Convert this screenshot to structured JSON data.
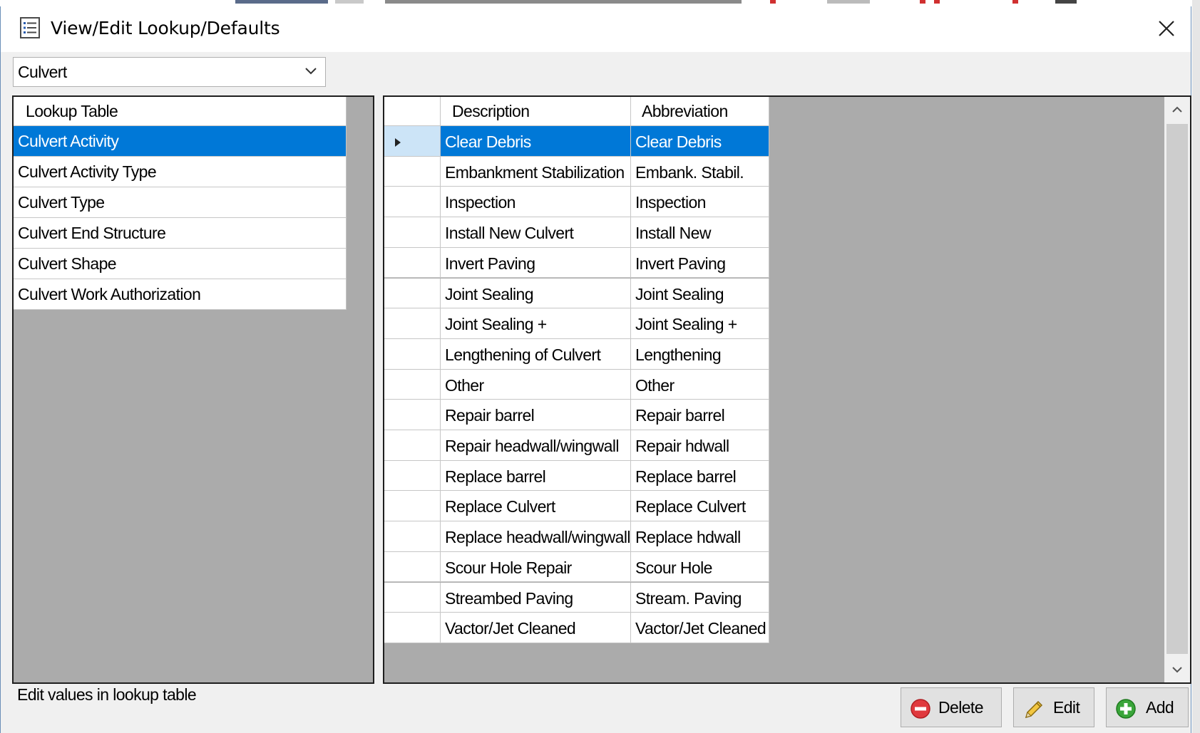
{
  "window": {
    "title": "View/Edit Lookup/Defaults",
    "icon": "list-icon"
  },
  "category_select": {
    "value": "Culvert"
  },
  "lookup_table": {
    "header": "Lookup Table",
    "items": [
      {
        "label": "Culvert Activity",
        "selected": true
      },
      {
        "label": "Culvert Activity Type",
        "selected": false
      },
      {
        "label": "Culvert Type",
        "selected": false
      },
      {
        "label": "Culvert End Structure",
        "selected": false
      },
      {
        "label": "Culvert Shape",
        "selected": false
      },
      {
        "label": "Culvert Work Authorization",
        "selected": false
      }
    ]
  },
  "values_grid": {
    "columns": [
      "Description",
      "Abbreviation"
    ],
    "rows": [
      [
        "Clear Debris",
        "Clear Debris"
      ],
      [
        "Embankment Stabilization",
        "Embank. Stabil."
      ],
      [
        "Inspection",
        "Inspection"
      ],
      [
        "Install New Culvert",
        "Install New"
      ],
      [
        "Invert Paving",
        "Invert Paving"
      ],
      [
        "Joint Sealing",
        "Joint Sealing"
      ],
      [
        "Joint Sealing +",
        "Joint Sealing +"
      ],
      [
        "Lengthening of Culvert",
        "Lengthening"
      ],
      [
        "Other",
        "Other"
      ],
      [
        "Repair barrel",
        "Repair barrel"
      ],
      [
        "Repair headwall/wingwall",
        "Repair hdwall"
      ],
      [
        "Replace barrel",
        "Replace barrel"
      ],
      [
        "Replace Culvert",
        "Replace Culvert"
      ],
      [
        "Replace headwall/wingwall",
        "Replace hdwall"
      ],
      [
        "Scour Hole Repair",
        "Scour Hole"
      ],
      [
        "Streambed Paving",
        "Stream. Paving"
      ],
      [
        "Vactor/Jet Cleaned",
        "Vactor/Jet Cleaned"
      ]
    ],
    "selected_row": 0
  },
  "status": {
    "text": "Edit values in lookup table"
  },
  "buttons": {
    "delete": "Delete",
    "edit": "Edit",
    "add": "Add"
  },
  "colors": {
    "selection": "#0078d7",
    "current_row_header": "#cce4f7",
    "grid_background": "#ababab",
    "delete_icon": "#e0393e",
    "add_icon": "#3aa53a"
  }
}
